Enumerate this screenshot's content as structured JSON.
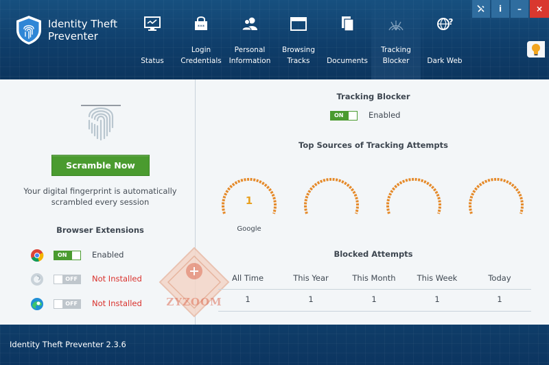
{
  "app": {
    "title": "Identity Theft\nPreventer",
    "version": "Identity Theft Preventer 2.3.6"
  },
  "window_controls": {
    "tools": "tools-icon",
    "info": "i",
    "minimize": "–",
    "close": "×"
  },
  "nav": [
    {
      "id": "status",
      "label": "Status",
      "icon": "monitor-icon"
    },
    {
      "id": "login",
      "label": "Login\nCredentials",
      "icon": "password-icon"
    },
    {
      "id": "personal",
      "label": "Personal\nInformation",
      "icon": "users-icon"
    },
    {
      "id": "browsing",
      "label": "Browsing\nTracks",
      "icon": "browser-window-icon"
    },
    {
      "id": "documents",
      "label": "Documents",
      "icon": "documents-icon"
    },
    {
      "id": "tracking",
      "label": "Tracking\nBlocker",
      "icon": "radar-icon",
      "active": true
    },
    {
      "id": "darkweb",
      "label": "Dark Web",
      "icon": "globe-question-icon"
    }
  ],
  "left": {
    "scramble_label": "Scramble Now",
    "description": "Your digital fingerprint is automatically scrambled every session",
    "extensions_title": "Browser Extensions",
    "extensions": [
      {
        "browser": "chrome-icon",
        "toggle": "ON",
        "state": "on",
        "status": "Enabled"
      },
      {
        "browser": "firefox-icon",
        "toggle": "OFF",
        "state": "off",
        "status": "Not Installed"
      },
      {
        "browser": "edge-icon",
        "toggle": "OFF",
        "state": "off",
        "status": "Not Installed"
      }
    ]
  },
  "right": {
    "tracking_title": "Tracking Blocker",
    "tracking_toggle": "ON",
    "tracking_status": "Enabled",
    "top_sources_title": "Top Sources of Tracking Attempts",
    "gauges": [
      {
        "value": "1",
        "label": "Google"
      },
      {
        "value": "",
        "label": ""
      },
      {
        "value": "",
        "label": ""
      },
      {
        "value": "",
        "label": ""
      }
    ],
    "blocked_title": "Blocked Attempts",
    "blocked": [
      {
        "period": "All Time",
        "count": "1"
      },
      {
        "period": "This Year",
        "count": "1"
      },
      {
        "period": "This Month",
        "count": "1"
      },
      {
        "period": "This Week",
        "count": "1"
      },
      {
        "period": "Today",
        "count": "1"
      }
    ]
  },
  "watermark": {
    "text": "ZYZOOM"
  },
  "colors": {
    "accent_green": "#4a9b2f",
    "gauge_orange": "#e8a020",
    "error_red": "#d9302b",
    "header_blue": "#0f3e6b"
  }
}
